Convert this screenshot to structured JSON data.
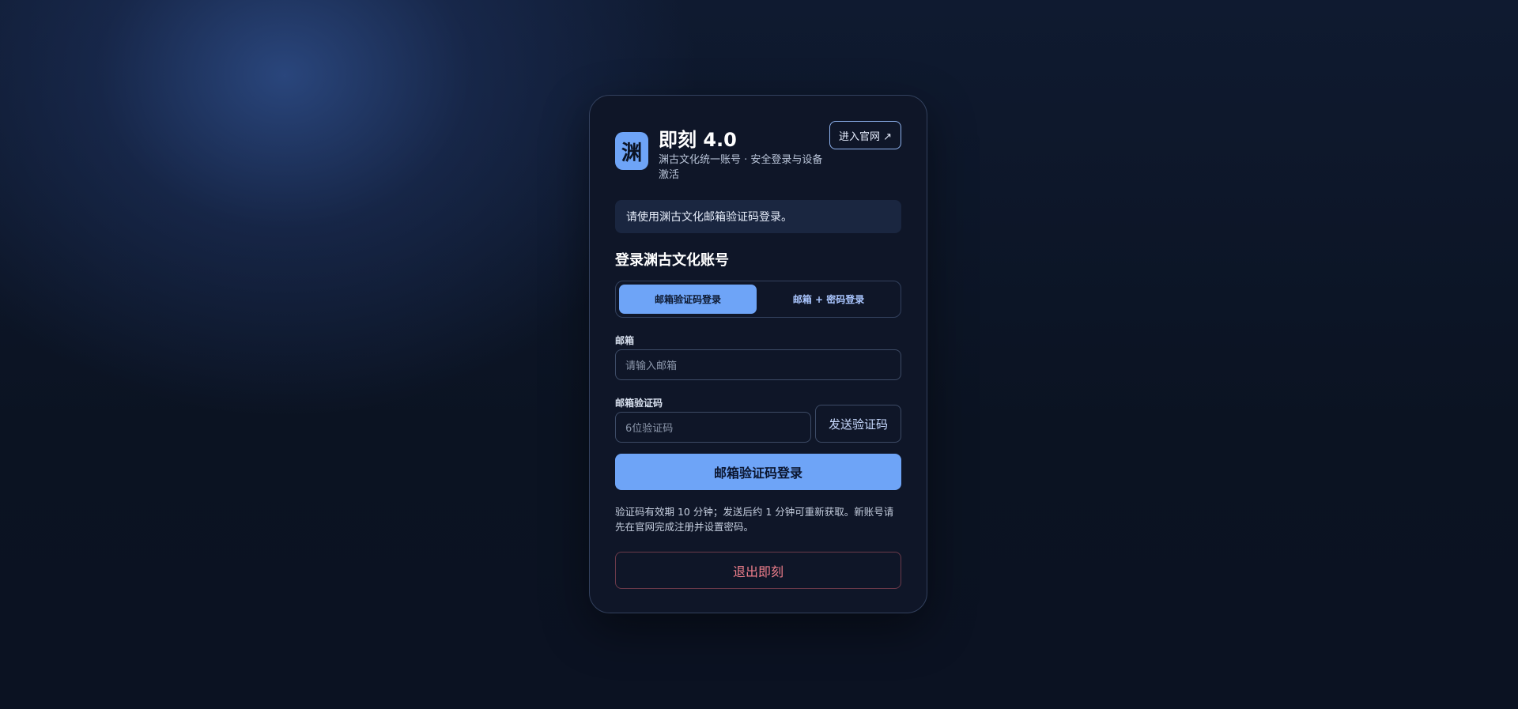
{
  "app": {
    "logo_char": "渊",
    "title": "即刻 4.0",
    "subtitle": "渊古文化统一账号 · 安全登录与设备激活",
    "site_button": "进入官网 ↗"
  },
  "notice": "请使用渊古文化邮箱验证码登录。",
  "login": {
    "section_title": "登录渊古文化账号",
    "tabs": [
      {
        "label": "邮箱验证码登录",
        "active": true
      },
      {
        "label": "邮箱 + 密码登录",
        "active": false
      }
    ],
    "email_label": "邮箱",
    "email_placeholder": "请输入邮箱",
    "code_label": "邮箱验证码",
    "code_placeholder": "6位验证码",
    "send_code_button": "发送验证码",
    "submit_button": "邮箱验证码登录",
    "hint": "验证码有效期 10 分钟；发送后约 1 分钟可重新获取。新账号请先在官网完成注册并设置密码。",
    "exit_button": "退出即刻"
  },
  "colors": {
    "accent": "#6ea4f7",
    "danger": "#f07f8c",
    "card_bg": "#0f1628"
  }
}
